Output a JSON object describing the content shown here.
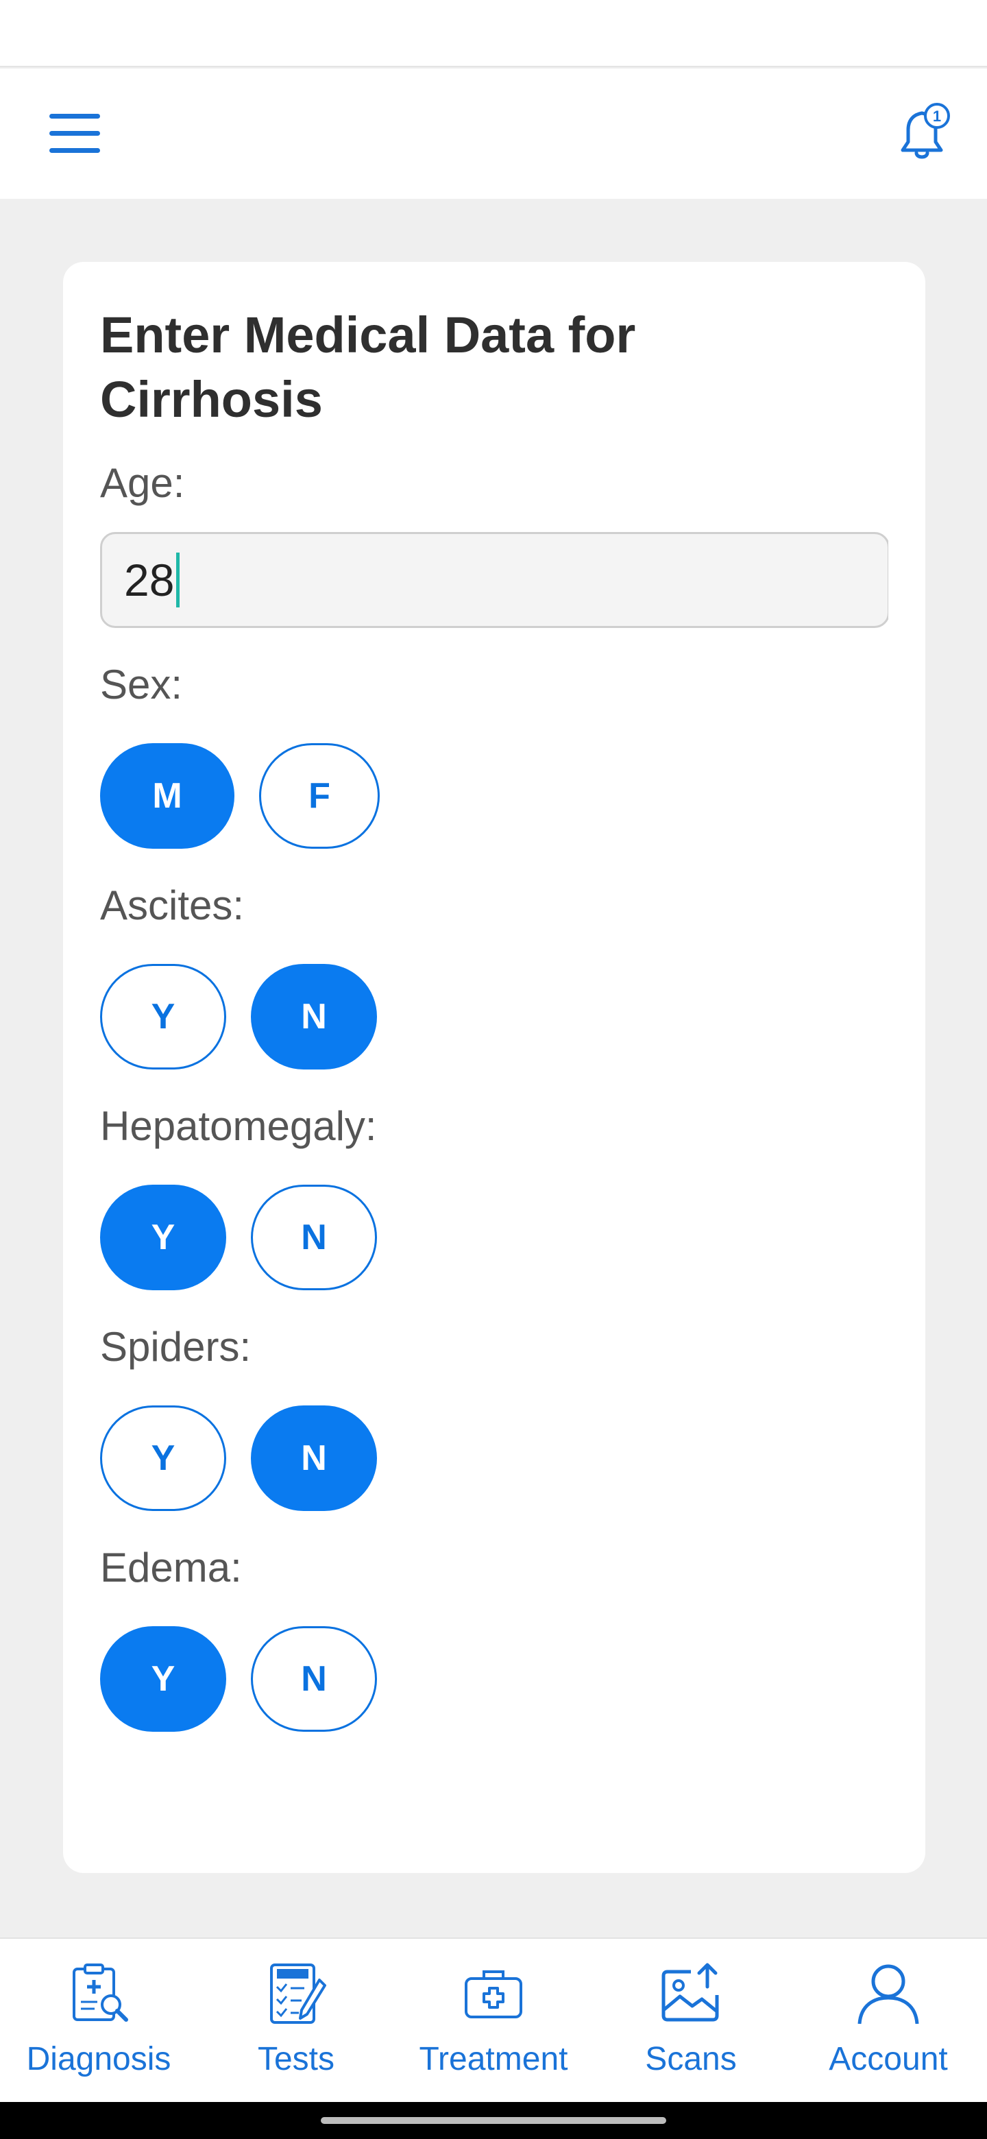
{
  "header": {
    "menu_icon": "hamburger-menu-icon",
    "notification_icon": "bell-icon",
    "notification_count": "1"
  },
  "form": {
    "title": "Enter Medical Data for Cirrhosis",
    "age": {
      "label": "Age:",
      "value": "28"
    },
    "sex": {
      "label": "Sex:",
      "options": [
        "M",
        "F"
      ],
      "selected": "M"
    },
    "ascites": {
      "label": "Ascites:",
      "options": [
        "Y",
        "N"
      ],
      "selected": "N"
    },
    "hepatomegaly": {
      "label": "Hepatomegaly:",
      "options": [
        "Y",
        "N"
      ],
      "selected": "Y"
    },
    "spiders": {
      "label": "Spiders:",
      "options": [
        "Y",
        "N"
      ],
      "selected": "N"
    },
    "edema": {
      "label": "Edema:",
      "options": [
        "Y",
        "N"
      ],
      "selected": "Y"
    }
  },
  "nav": {
    "items": [
      {
        "label": "Diagnosis",
        "icon": "clipboard-magnifier-icon"
      },
      {
        "label": "Tests",
        "icon": "test-checklist-icon"
      },
      {
        "label": "Treatment",
        "icon": "medical-kit-icon"
      },
      {
        "label": "Scans",
        "icon": "scan-image-upload-icon"
      },
      {
        "label": "Account",
        "icon": "user-icon"
      }
    ]
  },
  "colors": {
    "accent": "#0a7bf0",
    "nav_text": "#1a73d8",
    "background": "#efefef"
  }
}
